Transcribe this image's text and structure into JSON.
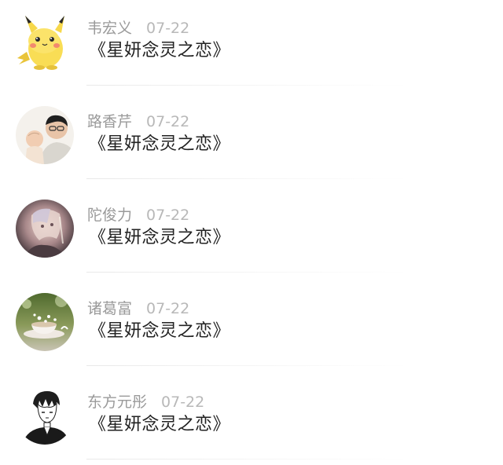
{
  "comments": [
    {
      "name": "韦宏义",
      "date": "07-22",
      "text": "《星妍念灵之恋》",
      "avatar_icon": "pikachu-avatar-icon"
    },
    {
      "name": "路香芹",
      "date": "07-22",
      "text": "《星妍念灵之恋》",
      "avatar_icon": "person-with-baby-avatar-icon"
    },
    {
      "name": "陀俊力",
      "date": "07-22",
      "text": "《星妍念灵之恋》",
      "avatar_icon": "anime-couple-avatar-icon"
    },
    {
      "name": "诸葛富",
      "date": "07-22",
      "text": "《星妍念灵之恋》",
      "avatar_icon": "teacup-flowers-avatar-icon"
    },
    {
      "name": "东方元彤",
      "date": "07-22",
      "text": "《星妍念灵之恋》",
      "avatar_icon": "manga-boy-avatar-icon"
    }
  ]
}
